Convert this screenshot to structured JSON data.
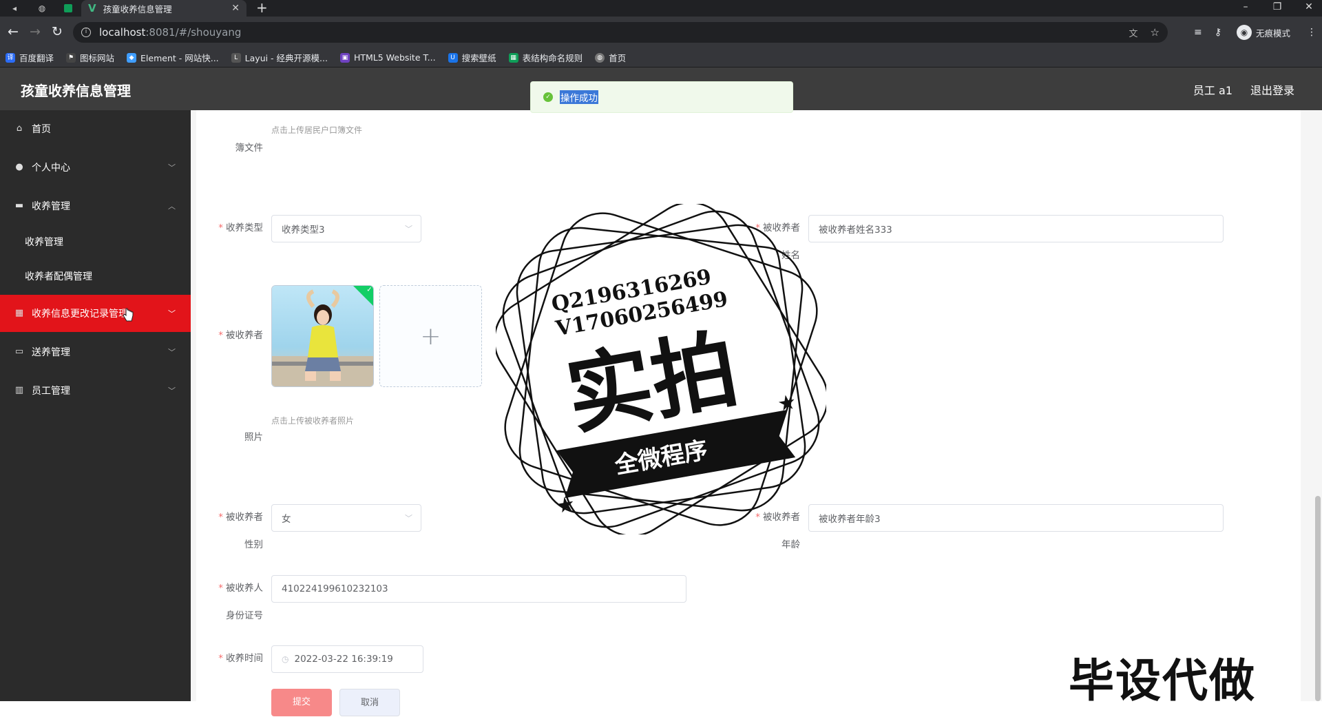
{
  "browser": {
    "tab_title": "孩童收养信息管理",
    "url_host": "localhost",
    "url_path": ":8081/#/shouyang",
    "incognito_label": "无痕模式",
    "bookmarks": [
      {
        "label": "百度翻译",
        "color": "#2b6cf6"
      },
      {
        "label": "图标网站",
        "color": "#444444"
      },
      {
        "label": "Element - 网站快...",
        "color": "#409eff"
      },
      {
        "label": "Layui - 经典开源模...",
        "color": "#555555"
      },
      {
        "label": "HTML5 Website T...",
        "color": "#6f42c1"
      },
      {
        "label": "搜索壁纸",
        "color": "#1a73e8"
      },
      {
        "label": "表结构命名规则",
        "color": "#0f9d58"
      },
      {
        "label": "首页",
        "color": "#777777"
      }
    ]
  },
  "header": {
    "title": "孩童收养信息管理",
    "user": "员工 a1",
    "logout": "退出登录"
  },
  "sidebar": {
    "items": [
      {
        "label": "首页",
        "icon": "home-icon"
      },
      {
        "label": "个人中心",
        "icon": "user-icon"
      },
      {
        "label": "收养管理",
        "icon": "book-icon"
      },
      {
        "label": "收养管理"
      },
      {
        "label": "收养者配偶管理"
      },
      {
        "label": "收养信息更改记录管理",
        "icon": "grid-icon"
      },
      {
        "label": "送养管理",
        "icon": "briefcase-icon"
      },
      {
        "label": "员工管理",
        "icon": "chart-icon"
      }
    ]
  },
  "toast": {
    "message": "操作成功"
  },
  "form": {
    "hukou": {
      "label": "簿文件",
      "hint": "点击上传居民户口簿文件"
    },
    "type": {
      "label": "收养类型",
      "value": "收养类型3"
    },
    "adoptee_name": {
      "label_line1": "被收养者",
      "label_line2": "姓名",
      "value": "被收养者姓名333"
    },
    "photo": {
      "label_top": "被收养者",
      "label_bottom": "照片",
      "hint": "点击上传被收养者照片",
      "plus": "+"
    },
    "gender": {
      "label_line1": "被收养者",
      "label_line2": "性别",
      "value": "女"
    },
    "age": {
      "label_line1": "被收养者",
      "label_line2": "年龄",
      "value": "被收养者年龄3"
    },
    "id_number": {
      "label_line1": "被收养人",
      "label_line2": "身份证号",
      "value": "410224199610232103"
    },
    "adopt_time": {
      "label": "收养时间",
      "value": "2022-03-22 16:39:19"
    },
    "submit_label": "提交",
    "cancel_label": "取消"
  },
  "overlay": {
    "stamp_line1": "Q2196316269",
    "stamp_line2": "V17060256499",
    "stamp_main": "实拍",
    "stamp_banner": "全微程序",
    "watermark": "毕设代做"
  }
}
